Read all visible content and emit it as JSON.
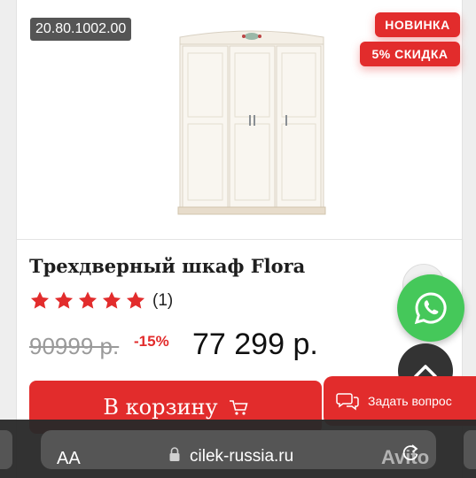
{
  "product": {
    "sku": "20.80.1002.00",
    "badge_new": "НОВИНКА",
    "badge_sale": "5% СКИДКА",
    "title": "Трехдверный шкаф Flora",
    "rating_count": "(1)",
    "rating_stars": 5,
    "old_price": "90999 р.",
    "discount": "-15%",
    "price": "77 299 р."
  },
  "actions": {
    "cart_label": "В корзину",
    "ask_label": "Задать вопрос"
  },
  "browser": {
    "aa_label": "AA",
    "url": "cilek-russia.ru",
    "watermark": "Avito"
  },
  "colors": {
    "accent_red": "#e22c2c",
    "whatsapp_green": "#45c85a",
    "sku_bg": "#555555"
  },
  "icons": [
    "whatsapp-icon",
    "chevron-up-icon",
    "chat-icon",
    "cart-icon",
    "lock-icon",
    "reload-icon",
    "star-icon"
  ]
}
